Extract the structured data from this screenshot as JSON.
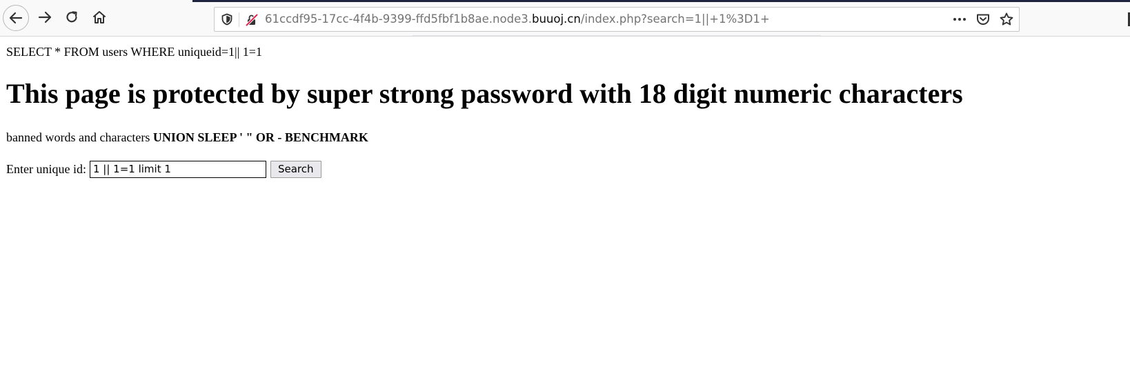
{
  "browser": {
    "url_prefix": "61ccdf95-17cc-4f4b-9399-ffd5fbf1b8ae.node3.",
    "url_host": "buuoj.cn",
    "url_path": "/index.php?search=1||+1%3D1+",
    "icons": {
      "back": "arrow-left-icon",
      "forward": "arrow-right-icon",
      "reload": "reload-icon",
      "home": "home-icon",
      "tracking": "shield-icon",
      "connection": "insecure-lock-icon",
      "more": "ellipsis-icon",
      "pocket": "pocket-icon",
      "bookmark": "star-icon"
    }
  },
  "page": {
    "query": "SELECT * FROM users WHERE uniqueid=1|| 1=1",
    "heading": "This page is protected by super strong password with 18 digit numeric characters",
    "banned_prefix": "banned words and characters ",
    "banned_list": "UNION SLEEP ' \" OR - BENCHMARK",
    "form": {
      "label": "Enter unique id:",
      "input_value": "1 || 1=1 limit 1",
      "button_label": "Search"
    }
  }
}
